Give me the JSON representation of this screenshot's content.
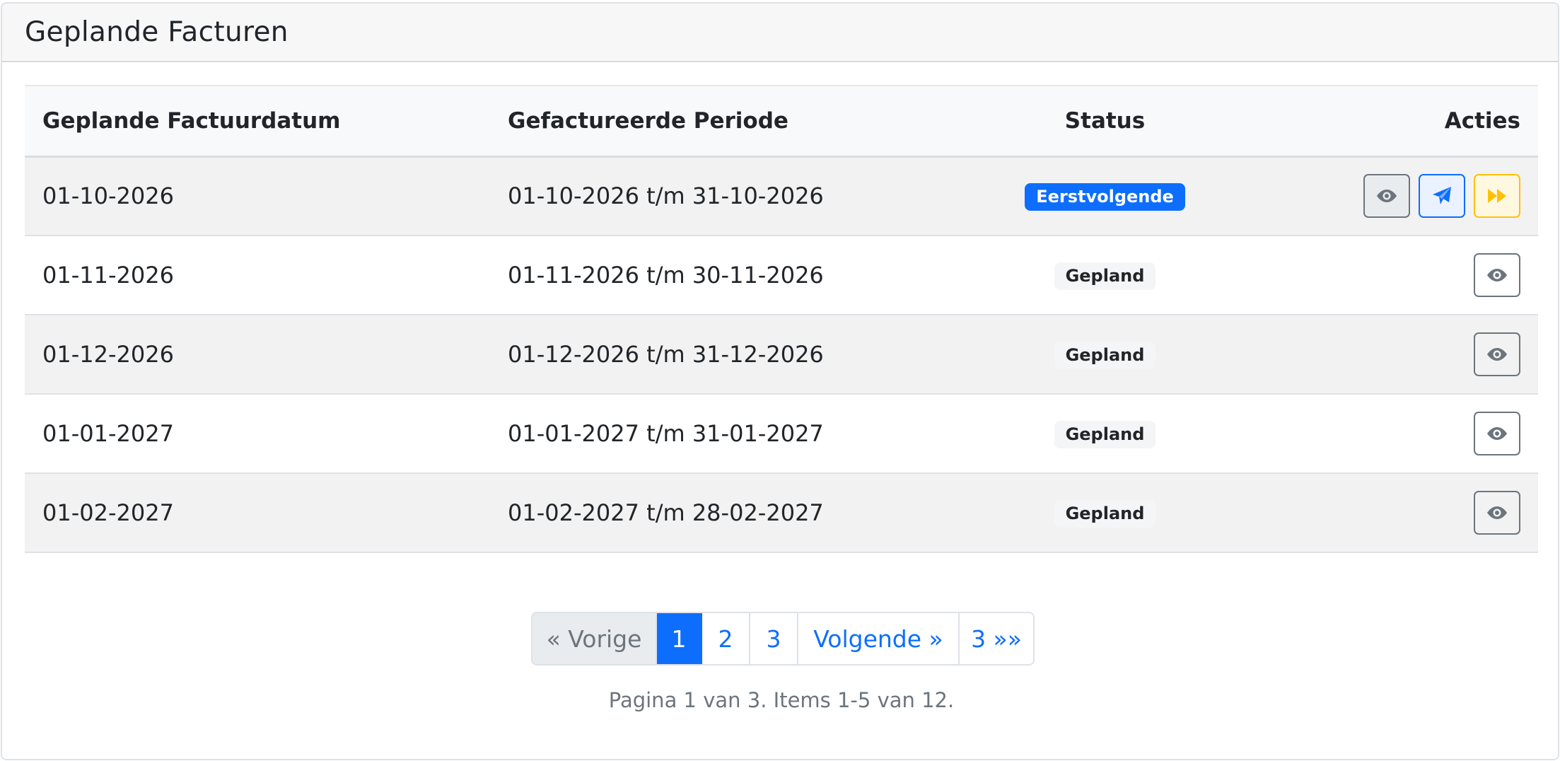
{
  "card": {
    "title": "Geplande Facturen"
  },
  "table": {
    "headers": {
      "date": "Geplande Factuurdatum",
      "period": "Gefactureerde Periode",
      "status": "Status",
      "actions": "Acties"
    },
    "rows": [
      {
        "date": "01-10-2026",
        "period": "01-10-2026 t/m 31-10-2026",
        "status": "Eerstvolgende",
        "status_type": "primary"
      },
      {
        "date": "01-11-2026",
        "period": "01-11-2026 t/m 30-11-2026",
        "status": "Gepland",
        "status_type": "light"
      },
      {
        "date": "01-12-2026",
        "period": "01-12-2026 t/m 31-12-2026",
        "status": "Gepland",
        "status_type": "light"
      },
      {
        "date": "01-01-2027",
        "period": "01-01-2027 t/m 31-01-2027",
        "status": "Gepland",
        "status_type": "light"
      },
      {
        "date": "01-02-2027",
        "period": "01-02-2027 t/m 28-02-2027",
        "status": "Gepland",
        "status_type": "light"
      }
    ],
    "action_icons": [
      "eye-icon",
      "paper-plane-icon",
      "fast-forward-icon"
    ]
  },
  "pagination": {
    "prev": "« Vorige",
    "pages": [
      "1",
      "2",
      "3"
    ],
    "active_page": "1",
    "next": "Volgende »",
    "last": "3 »»",
    "summary": "Pagina 1 van 3. Items 1-5 van 12."
  },
  "colors": {
    "primary": "#0d6efd",
    "warning": "#ffc107",
    "secondary": "#6c757d",
    "stripe": "#f2f2f2"
  }
}
